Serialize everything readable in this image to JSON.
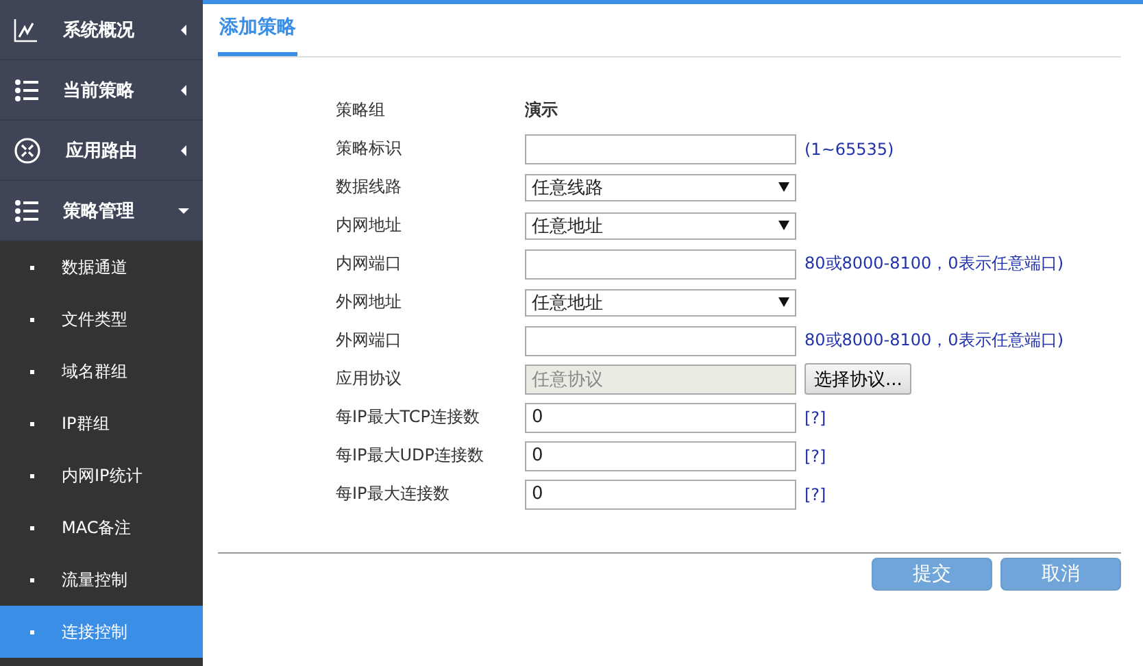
{
  "sidebar": {
    "items": [
      {
        "label": "系统概况",
        "expanded": false
      },
      {
        "label": "当前策略",
        "expanded": false
      },
      {
        "label": "应用路由",
        "expanded": false
      },
      {
        "label": "策略管理",
        "expanded": true,
        "children": [
          {
            "label": "数据通道",
            "selected": false
          },
          {
            "label": "文件类型",
            "selected": false
          },
          {
            "label": "域名群组",
            "selected": false
          },
          {
            "label": "IP群组",
            "selected": false
          },
          {
            "label": "内网IP统计",
            "selected": false
          },
          {
            "label": "MAC备注",
            "selected": false
          },
          {
            "label": "流量控制",
            "selected": false
          },
          {
            "label": "连接控制",
            "selected": true
          }
        ]
      }
    ]
  },
  "tabs": [
    {
      "label": "添加策略",
      "selected": true
    }
  ],
  "form": {
    "fields": [
      {
        "kind": "text",
        "label": "策略组",
        "value": "演示"
      },
      {
        "kind": "input",
        "label": "策略标识",
        "hint": "(1~65535)"
      },
      {
        "kind": "select",
        "label": "数据线路",
        "value": "任意线路"
      },
      {
        "kind": "select",
        "label": "内网地址",
        "value": "任意地址"
      },
      {
        "kind": "input",
        "label": "内网端口",
        "hint": "80或8000-8100，0表示任意端口)"
      },
      {
        "kind": "select",
        "label": "外网地址",
        "value": "任意地址"
      },
      {
        "kind": "input",
        "label": "外网端口",
        "hint": "80或8000-8100，0表示任意端口)"
      },
      {
        "kind": "picker",
        "label": "应用协议",
        "value": "任意协议",
        "button": "选择协议..."
      },
      {
        "kind": "input",
        "label": "每IP最大TCP连接数",
        "value": "0",
        "hint": "[?]"
      },
      {
        "kind": "input",
        "label": "每IP最大UDP连接数",
        "value": "0",
        "hint": "[?]"
      },
      {
        "kind": "input",
        "label": "每IP最大连接数",
        "value": "0",
        "hint": "[?]"
      }
    ]
  },
  "buttons": [
    "提交",
    "取消"
  ]
}
